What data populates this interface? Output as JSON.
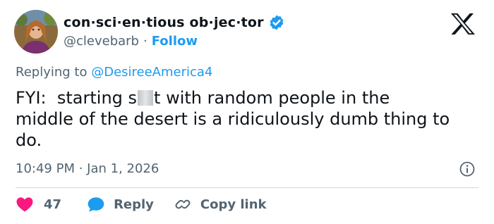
{
  "author": {
    "display_name": "con·sci·en·tious ob·jec·tor",
    "handle": "@clevebarb",
    "separator": "·",
    "follow_label": "Follow"
  },
  "reply_context": {
    "prefix": "Replying to ",
    "mention": "@DesireeAmerica4"
  },
  "tweet": {
    "text_part1": "FYI:  starting s",
    "text_part2": "t with random people in the\nmiddle of the desert is a ridiculously dumb thing to\ndo.",
    "timestamp": "10:49 PM · Jan 1, 2026"
  },
  "actions": {
    "like_count": "47",
    "reply_label": "Reply",
    "copy_link_label": "Copy link"
  },
  "colors": {
    "accent": "#1d9bf0",
    "like": "#f91880",
    "muted": "#536471",
    "text": "#0f1419"
  },
  "icons": [
    "avatar-photo",
    "verified-badge-icon",
    "x-logo-icon",
    "info-icon",
    "heart-icon",
    "reply-bubble-icon",
    "link-icon"
  ]
}
